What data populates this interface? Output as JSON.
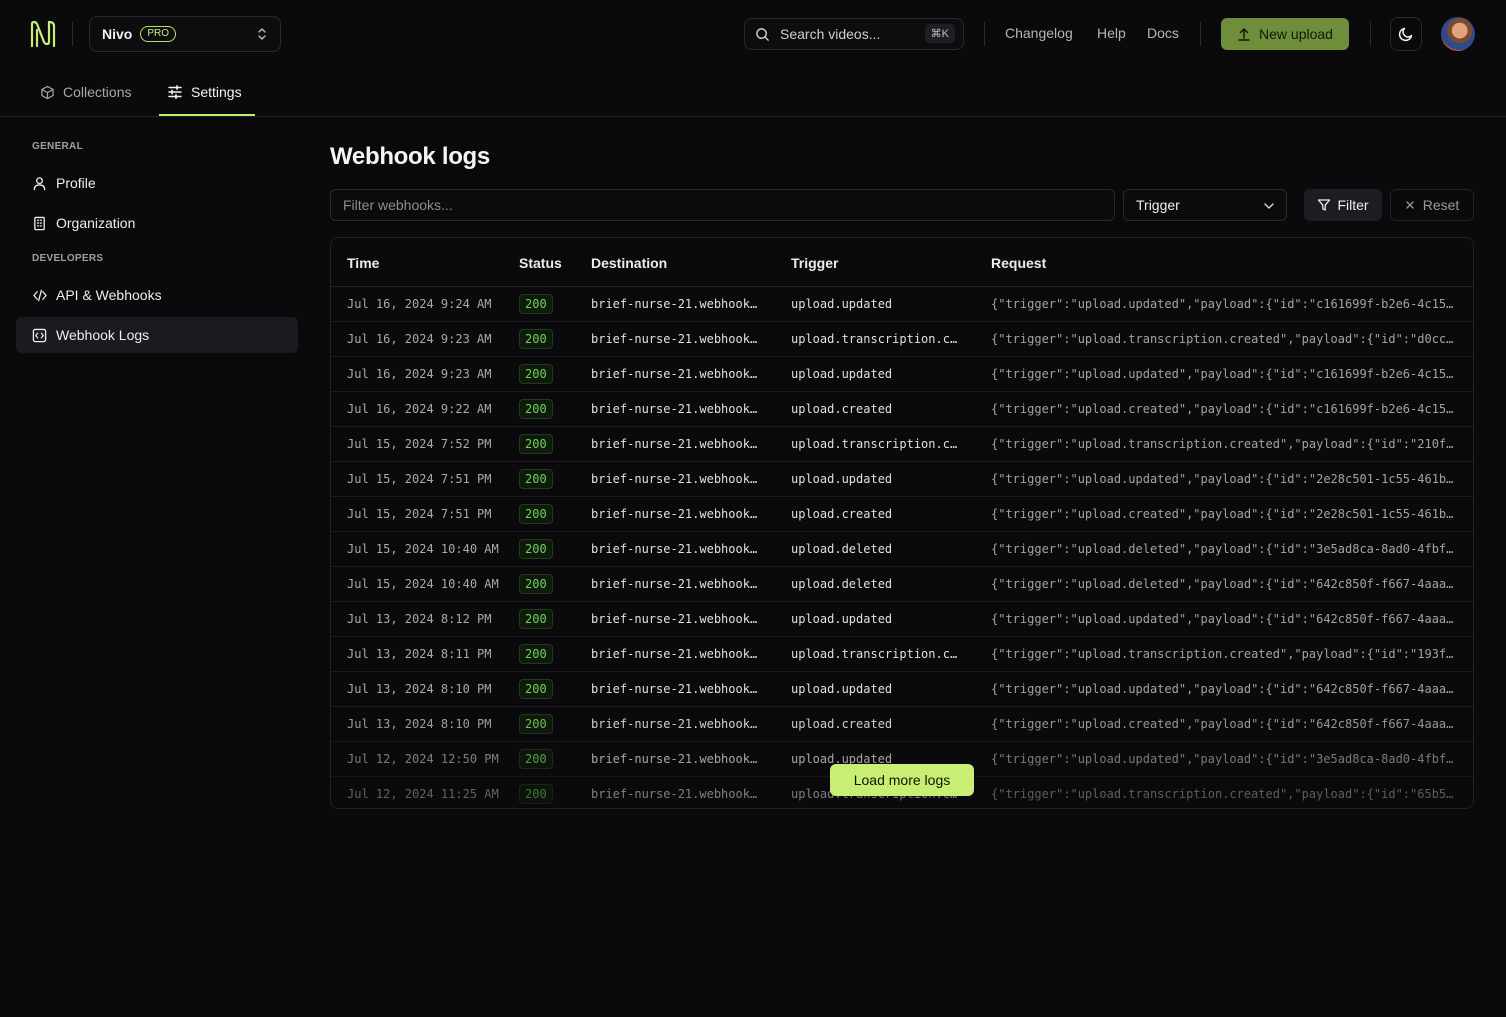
{
  "header": {
    "org_name": "Nivo",
    "plan_badge": "PRO",
    "search_placeholder": "Search videos...",
    "search_shortcut": "⌘K",
    "links": [
      "Changelog",
      "Help",
      "Docs"
    ],
    "upload_label": "New upload"
  },
  "tabs": [
    {
      "label": "Collections",
      "active": false
    },
    {
      "label": "Settings",
      "active": true
    }
  ],
  "sidebar": {
    "general_label": "GENERAL",
    "developers_label": "DEVELOPERS",
    "items": [
      {
        "label": "Profile"
      },
      {
        "label": "Organization"
      },
      {
        "label": "API & Webhooks"
      },
      {
        "label": "Webhook Logs",
        "active": true
      }
    ]
  },
  "main": {
    "title": "Webhook logs",
    "filter_placeholder": "Filter webhooks...",
    "trigger_select": "Trigger",
    "filter_label": "Filter",
    "reset_label": "Reset",
    "load_more_label": "Load more logs"
  },
  "table": {
    "columns": [
      "Time",
      "Status",
      "Destination",
      "Trigger",
      "Request"
    ],
    "rows": [
      {
        "time": "Jul 16, 2024 9:24 AM",
        "status": "200",
        "destination": "brief-nurse-21.webhook…",
        "trigger": "upload.updated",
        "request": "{\"trigger\":\"upload.updated\",\"payload\":{\"id\":\"c161699f-b2e6-4c15…"
      },
      {
        "time": "Jul 16, 2024 9:23 AM",
        "status": "200",
        "destination": "brief-nurse-21.webhook…",
        "trigger": "upload.transcription.c…",
        "request": "{\"trigger\":\"upload.transcription.created\",\"payload\":{\"id\":\"d0cc…"
      },
      {
        "time": "Jul 16, 2024 9:23 AM",
        "status": "200",
        "destination": "brief-nurse-21.webhook…",
        "trigger": "upload.updated",
        "request": "{\"trigger\":\"upload.updated\",\"payload\":{\"id\":\"c161699f-b2e6-4c15…"
      },
      {
        "time": "Jul 16, 2024 9:22 AM",
        "status": "200",
        "destination": "brief-nurse-21.webhook…",
        "trigger": "upload.created",
        "request": "{\"trigger\":\"upload.created\",\"payload\":{\"id\":\"c161699f-b2e6-4c15…"
      },
      {
        "time": "Jul 15, 2024 7:52 PM",
        "status": "200",
        "destination": "brief-nurse-21.webhook…",
        "trigger": "upload.transcription.c…",
        "request": "{\"trigger\":\"upload.transcription.created\",\"payload\":{\"id\":\"210f…"
      },
      {
        "time": "Jul 15, 2024 7:51 PM",
        "status": "200",
        "destination": "brief-nurse-21.webhook…",
        "trigger": "upload.updated",
        "request": "{\"trigger\":\"upload.updated\",\"payload\":{\"id\":\"2e28c501-1c55-461b…"
      },
      {
        "time": "Jul 15, 2024 7:51 PM",
        "status": "200",
        "destination": "brief-nurse-21.webhook…",
        "trigger": "upload.created",
        "request": "{\"trigger\":\"upload.created\",\"payload\":{\"id\":\"2e28c501-1c55-461b…"
      },
      {
        "time": "Jul 15, 2024 10:40 AM",
        "status": "200",
        "destination": "brief-nurse-21.webhook…",
        "trigger": "upload.deleted",
        "request": "{\"trigger\":\"upload.deleted\",\"payload\":{\"id\":\"3e5ad8ca-8ad0-4fbf…"
      },
      {
        "time": "Jul 15, 2024 10:40 AM",
        "status": "200",
        "destination": "brief-nurse-21.webhook…",
        "trigger": "upload.deleted",
        "request": "{\"trigger\":\"upload.deleted\",\"payload\":{\"id\":\"642c850f-f667-4aaa…"
      },
      {
        "time": "Jul 13, 2024 8:12 PM",
        "status": "200",
        "destination": "brief-nurse-21.webhook…",
        "trigger": "upload.updated",
        "request": "{\"trigger\":\"upload.updated\",\"payload\":{\"id\":\"642c850f-f667-4aaa…"
      },
      {
        "time": "Jul 13, 2024 8:11 PM",
        "status": "200",
        "destination": "brief-nurse-21.webhook…",
        "trigger": "upload.transcription.c…",
        "request": "{\"trigger\":\"upload.transcription.created\",\"payload\":{\"id\":\"193f…"
      },
      {
        "time": "Jul 13, 2024 8:10 PM",
        "status": "200",
        "destination": "brief-nurse-21.webhook…",
        "trigger": "upload.updated",
        "request": "{\"trigger\":\"upload.updated\",\"payload\":{\"id\":\"642c850f-f667-4aaa…"
      },
      {
        "time": "Jul 13, 2024 8:10 PM",
        "status": "200",
        "destination": "brief-nurse-21.webhook…",
        "trigger": "upload.created",
        "request": "{\"trigger\":\"upload.created\",\"payload\":{\"id\":\"642c850f-f667-4aaa…"
      },
      {
        "time": "Jul 12, 2024 12:50 PM",
        "status": "200",
        "destination": "brief-nurse-21.webhook…",
        "trigger": "upload.updated",
        "request": "{\"trigger\":\"upload.updated\",\"payload\":{\"id\":\"3e5ad8ca-8ad0-4fbf…"
      },
      {
        "time": "Jul 12, 2024 11:25 AM",
        "status": "200",
        "destination": "brief-nurse-21.webhook…",
        "trigger": "upload.transcription.c…",
        "request": "{\"trigger\":\"upload.transcription.created\",\"payload\":{\"id\":\"65b5…"
      }
    ]
  },
  "colors": {
    "accent": "#c8ef74",
    "upload_button": "#6f8e3c",
    "status_ok": "#6fd15a",
    "background": "#0a0a0c"
  }
}
